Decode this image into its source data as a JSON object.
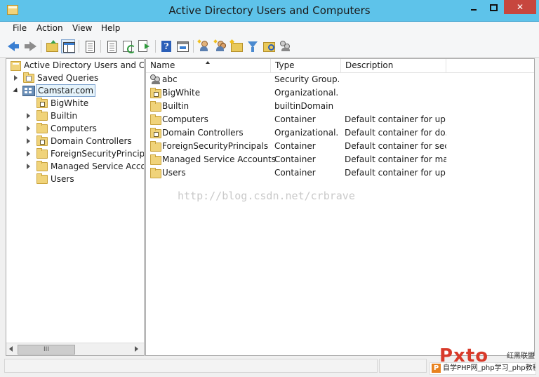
{
  "window": {
    "title": "Active Directory Users and Computers",
    "minimize": "",
    "maximize": "",
    "close": "✕"
  },
  "menu": [
    "File",
    "Action",
    "View",
    "Help"
  ],
  "toolbar": {
    "icons": [
      "back-arrow-icon",
      "forward-arrow-icon",
      "up-folder-icon",
      "show-hide-tree-icon",
      "properties-icon",
      "export-list-icon",
      "refresh-icon",
      "export-icon",
      "help-icon",
      "console-view-icon",
      "new-user-icon",
      "new-group-icon",
      "new-ou-icon",
      "filter-icon",
      "find-icon",
      "add-to-group-icon"
    ]
  },
  "tree": {
    "root": "Active Directory Users and Com",
    "saved_queries": "Saved Queries",
    "domain": "Camstar.com",
    "children": [
      {
        "label": "BigWhite",
        "expander": false,
        "type": "ou"
      },
      {
        "label": "Builtin",
        "expander": true,
        "type": "container"
      },
      {
        "label": "Computers",
        "expander": true,
        "type": "container"
      },
      {
        "label": "Domain Controllers",
        "expander": true,
        "type": "ou"
      },
      {
        "label": "ForeignSecurityPrincipals",
        "expander": true,
        "type": "container"
      },
      {
        "label": "Managed Service Accoun",
        "expander": true,
        "type": "container"
      },
      {
        "label": "Users",
        "expander": false,
        "type": "container"
      }
    ],
    "scroll_thumb": "III"
  },
  "list": {
    "columns": [
      "Name",
      "Type",
      "Description"
    ],
    "rows": [
      {
        "name": "abc",
        "type": "Security Group...",
        "description": "",
        "icon": "group"
      },
      {
        "name": "BigWhite",
        "type": "Organizational...",
        "description": "",
        "icon": "ou"
      },
      {
        "name": "Builtin",
        "type": "builtinDomain",
        "description": "",
        "icon": "container"
      },
      {
        "name": "Computers",
        "type": "Container",
        "description": "Default container for up...",
        "icon": "container"
      },
      {
        "name": "Domain Controllers",
        "type": "Organizational...",
        "description": "Default container for do...",
        "icon": "ou"
      },
      {
        "name": "ForeignSecurityPrincipals",
        "type": "Container",
        "description": "Default container for sec...",
        "icon": "container"
      },
      {
        "name": "Managed Service Accounts",
        "type": "Container",
        "description": "Default container for ma...",
        "icon": "container"
      },
      {
        "name": "Users",
        "type": "Container",
        "description": "Default container for up...",
        "icon": "container"
      }
    ]
  },
  "watermark": "http://blog.csdn.net/crbrave",
  "logo": {
    "big": "Pxto",
    "cn": "红黑联盟",
    "p": "P",
    "sub": "自学PHP网_php学习_php教程"
  }
}
